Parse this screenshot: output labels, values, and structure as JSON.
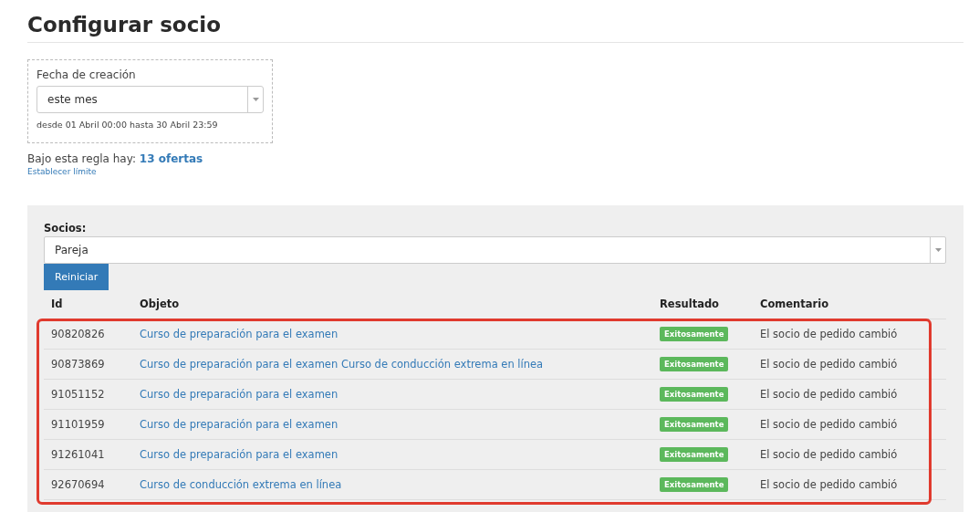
{
  "title": "Configurar socio",
  "filter": {
    "label": "Fecha de creación",
    "value": "este mes",
    "range": "desde 01 Abril 00:00 hasta 30 Abril 23:59"
  },
  "summary": {
    "text": "Bajo esta regla hay:",
    "count": "13 ofertas",
    "limit_link": "Establecer límite"
  },
  "partners": {
    "label": "Socios:",
    "value": "Pareja",
    "reset_button": "Reiniciar"
  },
  "table": {
    "columns": [
      "Id",
      "Objeto",
      "Resultado",
      "Comentario"
    ],
    "highlighted": true,
    "rows": [
      {
        "id": "90820826",
        "object": "Curso de preparación para el examen",
        "result": "Exitosamente",
        "comment": "El socio de pedido cambió"
      },
      {
        "id": "90873869",
        "object": "Curso de preparación para el examen Curso de conducción extrema en línea",
        "result": "Exitosamente",
        "comment": "El socio de pedido cambió"
      },
      {
        "id": "91051152",
        "object": "Curso de preparación para el examen",
        "result": "Exitosamente",
        "comment": "El socio de pedido cambió"
      },
      {
        "id": "91101959",
        "object": "Curso de preparación para el examen",
        "result": "Exitosamente",
        "comment": "El socio de pedido cambió"
      },
      {
        "id": "91261041",
        "object": "Curso de preparación para el examen",
        "result": "Exitosamente",
        "comment": "El socio de pedido cambió"
      },
      {
        "id": "92670694",
        "object": "Curso de conducción extrema en línea",
        "result": "Exitosamente",
        "comment": "El socio de pedido cambió"
      }
    ]
  }
}
